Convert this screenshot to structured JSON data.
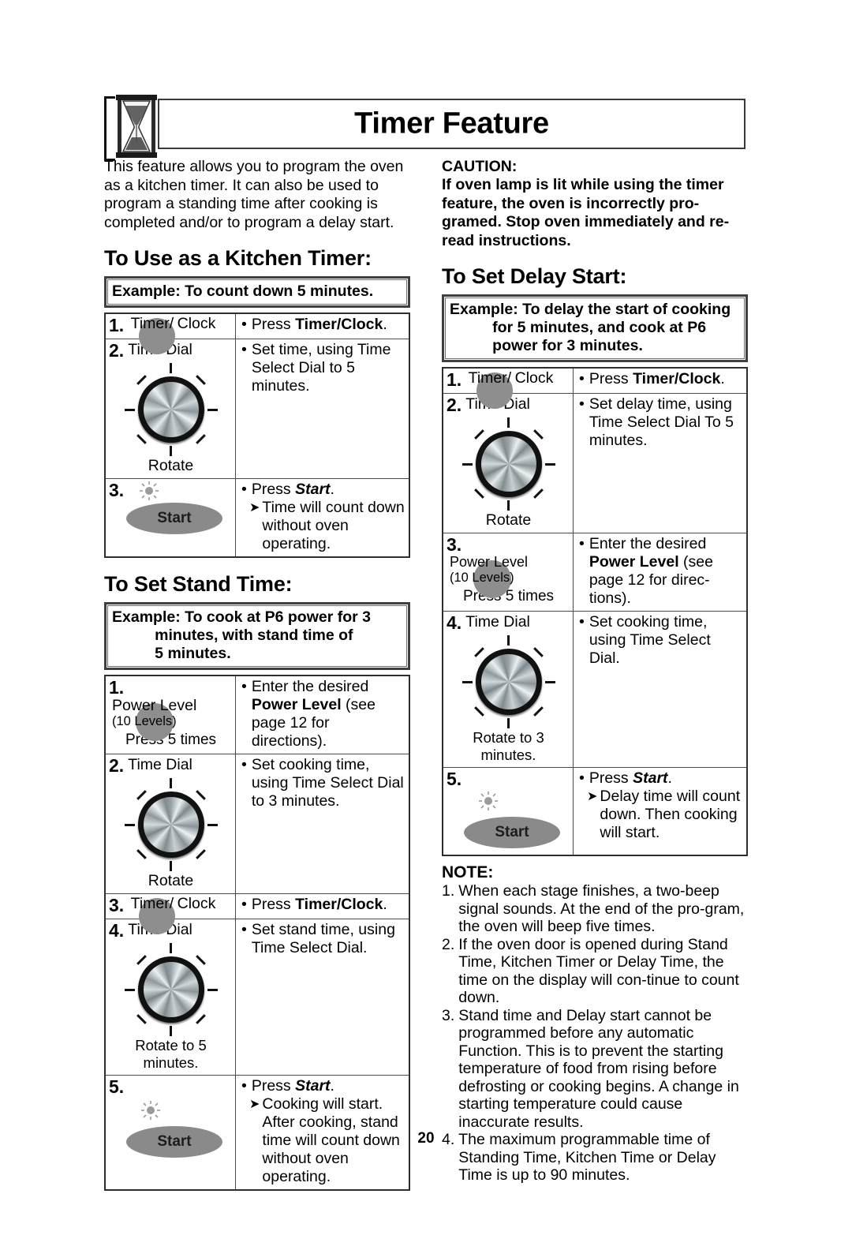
{
  "header": {
    "title": "Timer Feature",
    "icon": "hourglass-icon"
  },
  "intro": {
    "text": "This feature allows you to program the oven as a kitchen timer. It can also be used to program a standing time after cooking is completed and/or to program a delay start."
  },
  "caution": {
    "label": "CAUTION:",
    "text": "If oven lamp is lit while using the timer feature, the oven is incorrectly pro-gramed. Stop oven immediately and re-read instructions."
  },
  "sections": {
    "kitchen_timer": {
      "heading": "To Use  as a Kitchen Timer:",
      "example_lines": [
        "Example: To count down 5 minutes."
      ],
      "steps": [
        {
          "num": "1.",
          "key_lines": [
            "Timer/",
            "Clock"
          ],
          "action_bullet": "Press Timer/Clock.",
          "action_bold": "Timer/Clock"
        },
        {
          "num": "2.",
          "key_label": "Time Dial",
          "dial_caption": "Rotate",
          "action_bullet": "Set time, using Time Select Dial to 5 minutes."
        },
        {
          "num": "3.",
          "start_label": "Start",
          "action_bullet": "Press Start.",
          "action_arrow": "Time will count down without oven operating."
        }
      ]
    },
    "stand_time": {
      "heading": "To Set Stand Time:",
      "example_lines": [
        "Example: To cook at P6 power for 3",
        "          minutes, with stand time of",
        "          5 minutes."
      ],
      "steps": [
        {
          "num": "1.",
          "key_label": "Power Level",
          "key_sub": "(10 Levels)",
          "press_times": "Press 5 times",
          "action_bullet": "Enter the desired Power Level (see page 12 for directions)."
        },
        {
          "num": "2.",
          "key_label": "Time Dial",
          "dial_caption": "Rotate",
          "action_bullet": "Set cooking time, using Time Select Dial to 3 minutes."
        },
        {
          "num": "3.",
          "key_lines": [
            "Timer/",
            "Clock"
          ],
          "action_bullet": "Press Timer/Clock."
        },
        {
          "num": "4.",
          "key_label": "Time Dial",
          "dial_caption": "Rotate to 5 minutes.",
          "action_bullet": "Set stand time, using Time Select Dial."
        },
        {
          "num": "5.",
          "start_label": "Start",
          "action_bullet": "Press Start.",
          "action_arrow": "Cooking will start. After cooking, stand time will count down without oven operating."
        }
      ]
    },
    "delay_start": {
      "heading": "To Set Delay Start:",
      "example_lines": [
        "Example: To delay the start of cooking",
        "          for 5 minutes, and cook at P6",
        "          power for 3 minutes."
      ],
      "steps": [
        {
          "num": "1.",
          "key_lines": [
            "Timer/",
            "Clock"
          ],
          "action_bullet": "Press Timer/Clock."
        },
        {
          "num": "2.",
          "key_label": "Time Dial",
          "dial_caption": "Rotate",
          "action_bullet": "Set delay time, using Time Select Dial To 5 minutes."
        },
        {
          "num": "3.",
          "key_label": "Power Level",
          "key_sub": "(10 Levels)",
          "press_times": "Press 5 times",
          "action_bullet": "Enter the desired Power Level (see page 12 for direc-tions)."
        },
        {
          "num": "4.",
          "key_label": "Time Dial",
          "dial_caption": "Rotate to 3 minutes.",
          "action_bullet": "Set cooking time, using Time Select Dial."
        },
        {
          "num": "5.",
          "start_label": "Start",
          "action_bullet": "Press Start.",
          "action_arrow": "Delay time will count down. Then cooking will start."
        }
      ]
    }
  },
  "note": {
    "label": "NOTE:",
    "items": [
      {
        "n": "1.",
        "text": "When each stage finishes, a two-beep signal sounds. At the end of the pro-gram, the oven will beep five times."
      },
      {
        "n": "2.",
        "text": "If the oven door is opened during Stand Time, Kitchen Timer or Delay Time, the time on the display will con-tinue to count down."
      },
      {
        "n": "3.",
        "text": "Stand time and Delay start cannot be programmed before any automatic Function. This is to prevent the starting temperature of food from rising before defrosting or cooking begins. A change in starting temperature could cause inaccurate results."
      },
      {
        "n": "4.",
        "text": "The maximum programmable time of Standing Time, Kitchen Time or Delay Time is up to 90 minutes."
      }
    ]
  },
  "footer": {
    "page_number": "20"
  },
  "labels": {
    "bullet": "•",
    "arrow": "➤",
    "press_word": "Press ",
    "start_word": "Start",
    "period": "."
  },
  "colors": {
    "ink": "#000000",
    "rule": "#3a3a3a",
    "smudge_gray": "#8e8e8e",
    "start_gray": "#8a8a8a",
    "dial_dark": "#111111"
  }
}
